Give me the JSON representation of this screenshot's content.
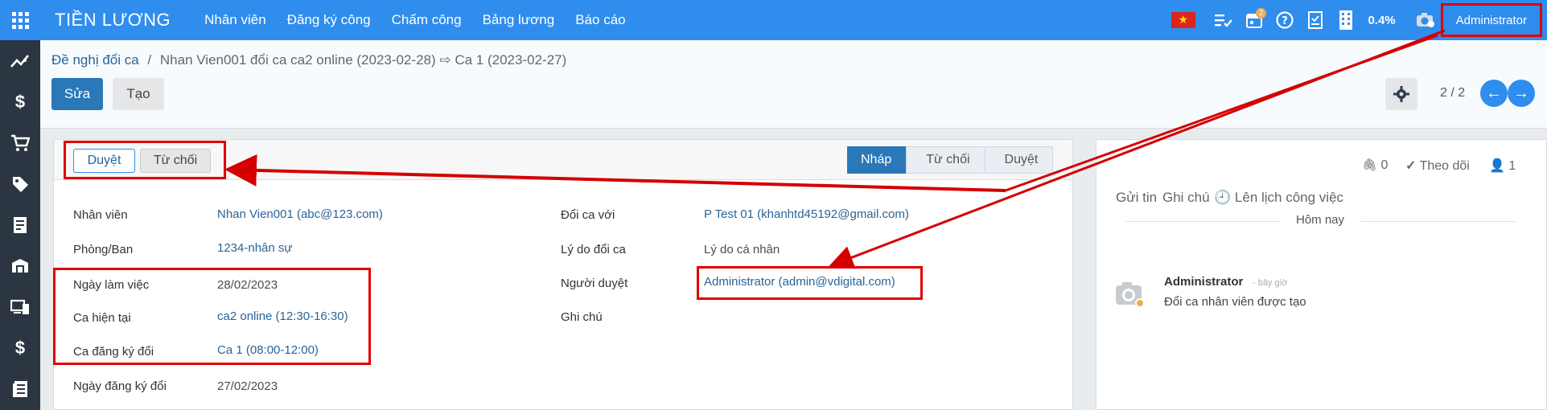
{
  "topbar": {
    "brand": "TIỀN LƯƠNG",
    "menu": [
      "Nhân viên",
      "Đăng ký công",
      "Chấm công",
      "Bảng lương",
      "Báo cáo"
    ],
    "activity_count": "2",
    "percent": "0.4%",
    "user": "Administrator"
  },
  "control_panel": {
    "breadcrumb_parent": "Đề nghị đổi ca",
    "breadcrumb_separator": "/",
    "breadcrumb_current": "Nhan Vien001 đổi ca ca2 online (2023-02-28) ⇨ Ca 1 (2023-02-27)",
    "edit_label": "Sửa",
    "create_label": "Tạo",
    "pager": "2 / 2"
  },
  "form": {
    "approve_label": "Duyệt",
    "reject_label": "Từ chối",
    "stages": [
      "Nháp",
      "Từ chối",
      "Duyệt"
    ],
    "active_stage": "Nháp",
    "left_fields": [
      {
        "label": "Nhân viên",
        "value": "Nhan Vien001 (abc@123.com)"
      },
      {
        "label": "Phòng/Ban",
        "value": "1234-nhân sự"
      },
      {
        "label": "Ngày làm việc",
        "value": "28/02/2023"
      },
      {
        "label": "Ca hiện tại",
        "value": "ca2 online (12:30-16:30)"
      },
      {
        "label": "Ca đăng ký đổi",
        "value": "Ca 1 (08:00-12:00)"
      },
      {
        "label": "Ngày đăng ký đổi",
        "value": "27/02/2023"
      }
    ],
    "right_fields": [
      {
        "label": "Đổi ca với",
        "value": "P Test 01 (khanhtd45192@gmail.com)"
      },
      {
        "label": "Lý do đổi ca",
        "value": "Lý do cá nhân"
      },
      {
        "label": "Người duyệt",
        "value": "Administrator (admin@vdigital.com)"
      },
      {
        "label": "Ghi chú",
        "value": ""
      }
    ]
  },
  "chatter": {
    "attachments": "0",
    "follow_label": "Theo dõi",
    "followers": "1",
    "send_message": "Gửi tin",
    "log_note": "Ghi chú",
    "schedule_activity": "Lên lịch công việc",
    "today": "Hôm nay",
    "message": {
      "author": "Administrator",
      "time": "- bây giờ",
      "body": "Đổi ca nhân viên được tạo"
    }
  },
  "colors": {
    "topbar": "#2f8ded",
    "primary": "#2a78b8",
    "highlight": "#e00000",
    "sidebar": "#2b3642"
  }
}
